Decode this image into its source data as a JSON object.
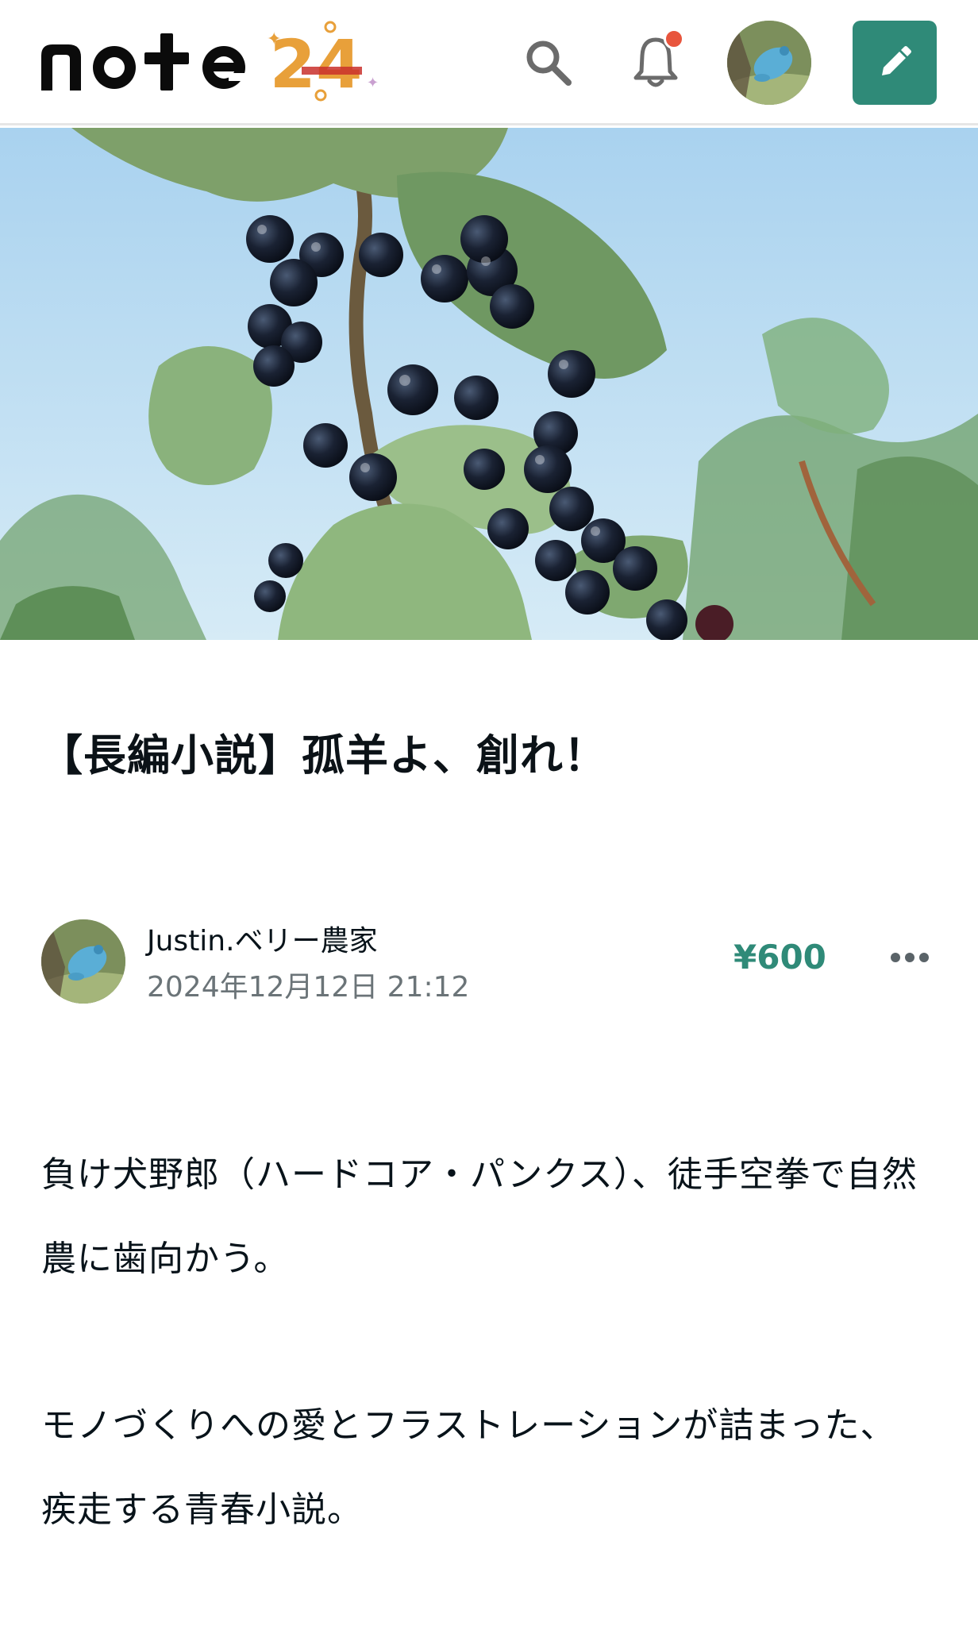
{
  "header": {
    "logo_text": "note",
    "logo_badge": "24",
    "icons": {
      "search": "search-icon",
      "notifications": "bell-icon",
      "avatar": "frog-avatar",
      "write": "pencil-icon"
    },
    "colors": {
      "accent": "#2f8a78",
      "notification_dot": "#e8553d"
    }
  },
  "article": {
    "title": "【長編小説】孤羊よ、創れ！",
    "author": {
      "name": "Justin.ベリー農家",
      "date": "2024年12月12日 21:12"
    },
    "price": "¥600",
    "body": [
      "負け犬野郎（ハードコア・パンクス）、徒手空拳で自然農に歯向かう。",
      "モノづくりへの愛とフラストレーションが詰まった、疾走する青春小説。"
    ]
  }
}
